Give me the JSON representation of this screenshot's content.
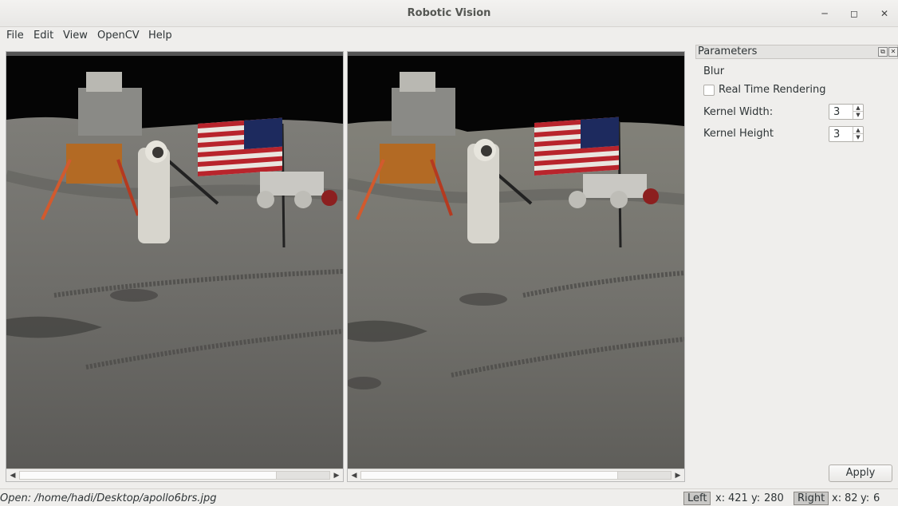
{
  "window": {
    "title": "Robotic Vision"
  },
  "menu": [
    "File",
    "Edit",
    "View",
    "OpenCV",
    "Help"
  ],
  "panel": {
    "title": "Parameters",
    "section": "Blur",
    "realtime_label": "Real Time Rendering",
    "realtime_checked": false,
    "kernel_width_label": "Kernel Width:",
    "kernel_width": "3",
    "kernel_height_label": "Kernel Height",
    "kernel_height": "3",
    "apply_label": "Apply"
  },
  "status": {
    "message": "Open: /home/hadi/Desktop/apollo6brs.jpg",
    "left_label": "Left",
    "left_x_label": "x:",
    "left_x": "421",
    "left_y_label": "y:",
    "left_y": "280",
    "right_label": "Right",
    "right_x_label": "x:",
    "right_x": "82",
    "right_y_label": "y:",
    "right_y": "6"
  },
  "colors": {
    "space": "#050505",
    "regolith": "#777672",
    "flag_red": "#b8242c",
    "flag_blue": "#1d2a5e"
  },
  "icons": [
    "minimize-icon",
    "maximize-icon",
    "close-icon",
    "float-icon",
    "dock-close-icon",
    "chevron-left-icon",
    "chevron-right-icon",
    "spin-up-icon",
    "spin-down-icon"
  ]
}
